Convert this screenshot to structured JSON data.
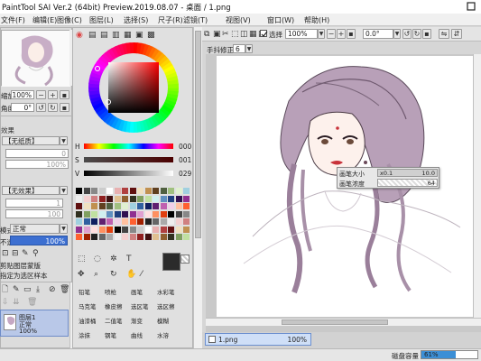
{
  "window": {
    "title": "PaintTool SAI Ver.2 (64bit) Preview.2019.08.07 - 桌面 / 1.png"
  },
  "menu": [
    "文件(F)",
    "编辑(E)",
    "图像(C)",
    "图层(L)",
    "选择(S)",
    "尺子(R)",
    "滤镜(T)",
    "视图(V)",
    "窗口(W)",
    "帮助(H)"
  ],
  "navigator": {
    "zoom_label": "缩放",
    "zoom_value": "100%",
    "angle_label": "角度",
    "angle_value": "0°"
  },
  "layer_effects": {
    "section_label": "效果",
    "texture_label": "【无纸质】",
    "texture_value": "0",
    "texture_scale": "100%",
    "effect_label": "【无效果】",
    "effect_width": "1",
    "effect_strength": "100",
    "blend_label": "模式",
    "blend_value": "正常",
    "opacity_label": "不透明度",
    "opacity_value": "100%",
    "protect_opacity": "保护不透明度",
    "clip_group": "剪贴图层蒙版",
    "selection_source": "指定为选区样本"
  },
  "layers": [
    {
      "name": "图层1",
      "mode": "正常",
      "opacity": "100%"
    }
  ],
  "color_panel": {
    "h_label": "H",
    "h_value": "000",
    "s_label": "S",
    "s_value": "001",
    "v_label": "V",
    "v_value": "029"
  },
  "tools_grid": [
    "铅笔",
    "喷枪",
    "画笔",
    "水彩笔",
    "马克笔",
    "橡皮擦",
    "选区笔",
    "选区擦",
    "油漆桶",
    "二值笔",
    "渐变",
    "模糊",
    "涂抹",
    "钢笔",
    "曲线",
    "水溶"
  ],
  "canvas_toolbar": {
    "selection_label": "选择",
    "zoom_value": "100%",
    "angle_value": "0.0°",
    "stabilizer_label": "手抖修正",
    "stabilizer_value": "6"
  },
  "brush_popup": {
    "size_label": "画笔大小",
    "size_mult": "x0.1",
    "size_value": "10.0",
    "density_label": "画笔浓度",
    "density_value": "64"
  },
  "document_tab": {
    "name": "1.png",
    "zoom": "100%"
  },
  "status": {
    "memory_label": "磁盘容量",
    "memory_value": "61%",
    "memory_fraction": 0.61
  },
  "colors": {
    "accent": "#3c6fd1",
    "hair": "#9a7f9a",
    "lips": "#c8323a",
    "panel": "#dcdcdc"
  }
}
